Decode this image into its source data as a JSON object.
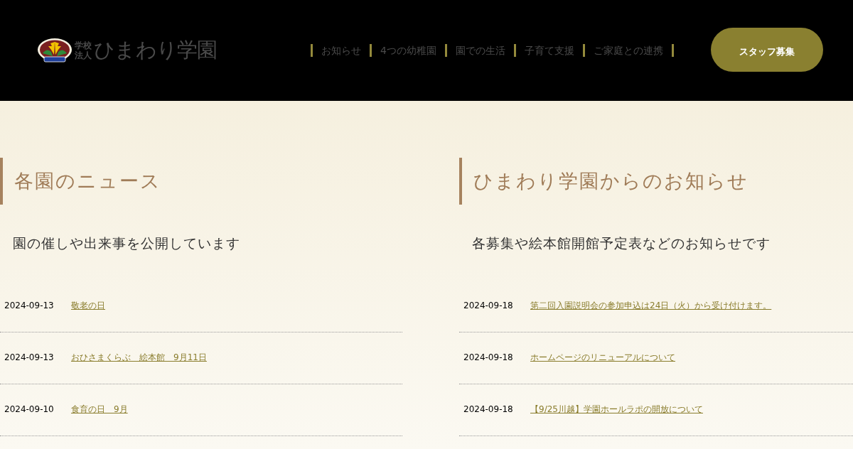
{
  "header": {
    "logo": {
      "small": [
        "学校",
        "法人"
      ],
      "name": "ひまわり学園"
    },
    "nav": [
      "お知らせ",
      "4つの幼稚園",
      "園での生活",
      "子育て支援",
      "ご家庭との連携"
    ],
    "staff_button": "スタッフ募集"
  },
  "sections": [
    {
      "title": "各園のニュース",
      "lead": "園の催しや出来事を公開しています",
      "items": [
        {
          "date": "2024-09-13",
          "title": "敬老の日"
        },
        {
          "date": "2024-09-13",
          "title": "おひさまくらぶ　絵本館　9月11日"
        },
        {
          "date": "2024-09-10",
          "title": "食育の日　9月"
        }
      ]
    },
    {
      "title": "ひまわり学園からのお知らせ",
      "lead": "各募集や絵本館開館予定表などのお知らせです",
      "items": [
        {
          "date": "2024-09-18",
          "title": "第二回入園説明会の参加申込は24日（火）から受け付けます。"
        },
        {
          "date": "2024-09-18",
          "title": "ホームページのリニューアルについて"
        },
        {
          "date": "2024-09-18",
          "title": "【9/25川越】学園ホールラポの開放について"
        }
      ]
    }
  ]
}
